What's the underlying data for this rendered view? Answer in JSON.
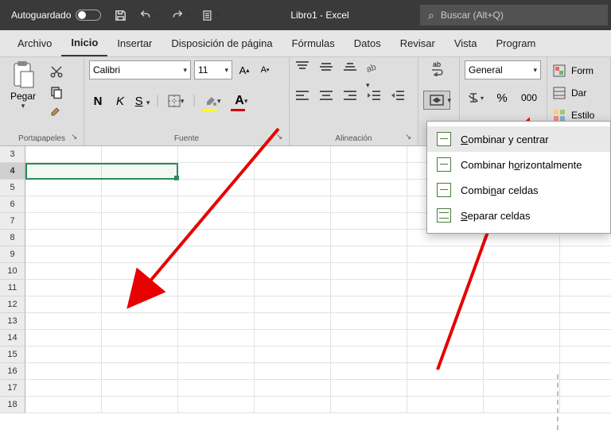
{
  "titlebar": {
    "autosave_label": "Autoguardado",
    "title": "Libro1  -  Excel",
    "search_placeholder": "Buscar (Alt+Q)"
  },
  "tabs": {
    "archivo": "Archivo",
    "inicio": "Inicio",
    "insertar": "Insertar",
    "disposicion": "Disposición de página",
    "formulas": "Fórmulas",
    "datos": "Datos",
    "revisar": "Revisar",
    "vista": "Vista",
    "programador": "Program"
  },
  "ribbon": {
    "portapapeles": {
      "pegar": "Pegar",
      "label": "Portapapeles"
    },
    "fuente": {
      "font": "Calibri",
      "size": "11",
      "bold": "N",
      "italic": "K",
      "underline": "S",
      "label": "Fuente"
    },
    "alineacion": {
      "abc": "ab",
      "label": "Alineación"
    },
    "numero": {
      "format": "General"
    },
    "estilos": {
      "form": "Form",
      "dar": "Dar",
      "estilo": "Estilo"
    }
  },
  "dropdown": {
    "combinar_centrar": "Combinar y centrar",
    "combinar_horiz": "Combinar horizontalmente",
    "combinar_celdas": "Combinar celdas",
    "separar_celdas": "Separar celdas"
  },
  "rows": [
    "3",
    "4",
    "5",
    "6",
    "7",
    "8",
    "9",
    "10",
    "11",
    "12",
    "13",
    "14",
    "15",
    "16",
    "17",
    "18"
  ]
}
